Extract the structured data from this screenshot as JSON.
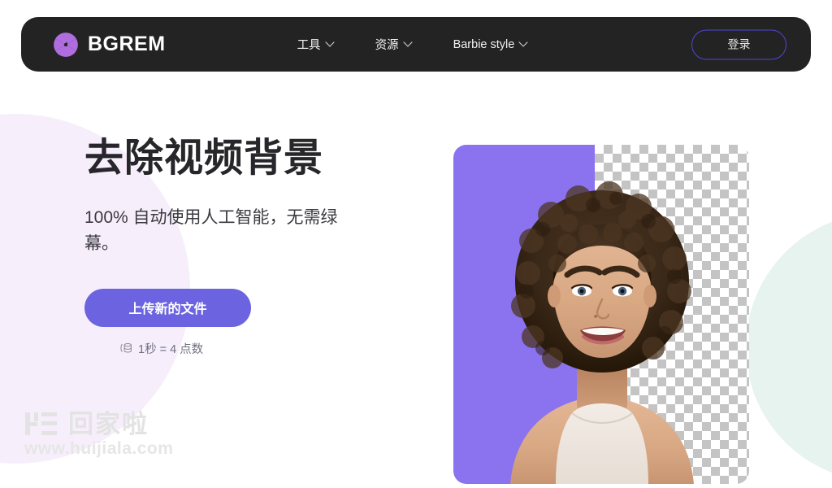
{
  "brand": {
    "name": "BGREM",
    "logo_icon": "aperture-icon",
    "logo_color": "#b06de0"
  },
  "header": {
    "background": "#232323",
    "nav": [
      {
        "label": "工具",
        "icon": "chevron-down-icon"
      },
      {
        "label": "资源",
        "icon": "chevron-down-icon"
      },
      {
        "label": "Barbie style",
        "icon": "chevron-down-icon"
      }
    ],
    "login_label": "登录",
    "login_border_color": "#4f47d4"
  },
  "hero": {
    "title": "去除视频背景",
    "subtitle": "100% 自动使用人工智能，无需绿幕。",
    "upload_label": "上传新的文件",
    "upload_color": "#6c63e0",
    "credit_icon": "coin-stack-icon",
    "credit_note": "1秒 = 4 点数",
    "media": {
      "alt": "before-after-portrait",
      "before_background_color": "#8b73f0",
      "after_background": "transparency-checkerboard"
    }
  },
  "decor": {
    "left_blob_color": "#f7eefb",
    "right_blob_color": "#e7f3ef"
  },
  "watermark": {
    "logo_icon": "huijiala-logo-icon",
    "text": "回家啦",
    "url": "www.huijiala.com"
  }
}
